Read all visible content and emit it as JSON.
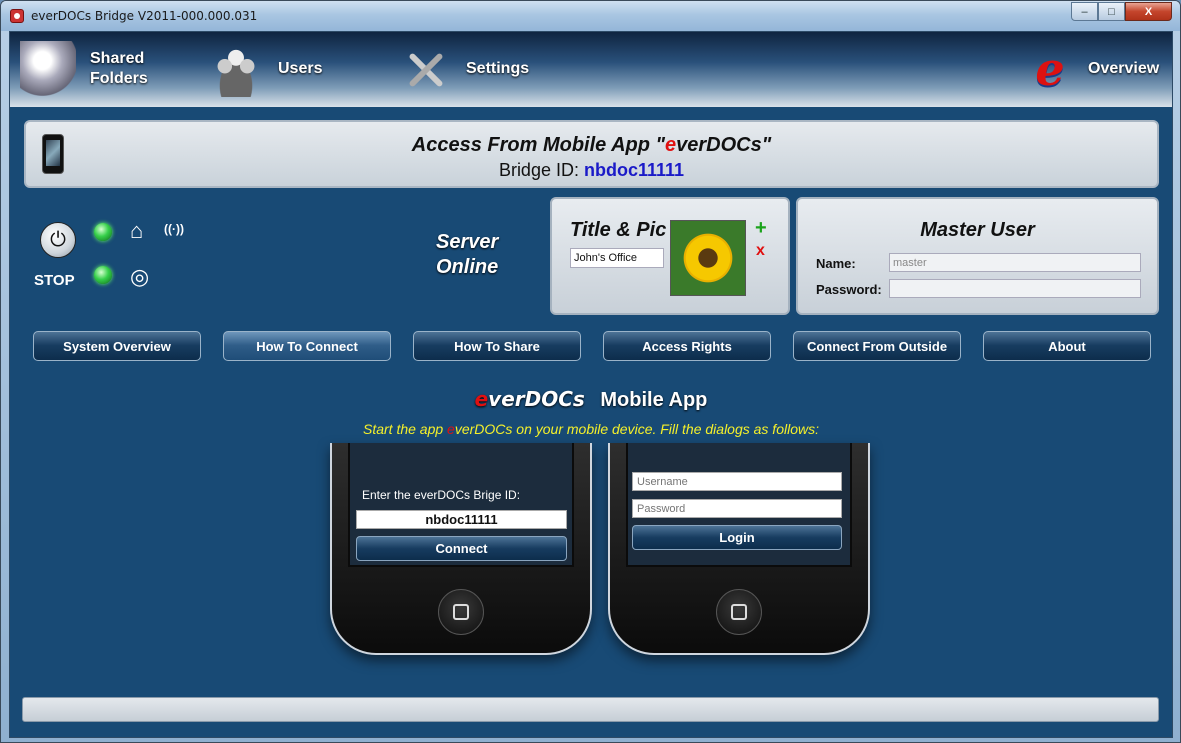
{
  "window": {
    "title": "everDOCs Bridge V2011-000.000.031",
    "min": "–",
    "max": "□",
    "close": "X"
  },
  "nav": {
    "shared_folders": "Shared\nFolders",
    "users": "Users",
    "settings": "Settings",
    "overview": "Overview",
    "overview_logo": "e"
  },
  "access": {
    "prefix": "Access From Mobile App \"",
    "e": "e",
    "rest": "verDOCs\"",
    "bridge_label": "Bridge ID: ",
    "bridge_id": "nbdoc11111"
  },
  "status": {
    "stop": "STOP",
    "server_online": "Server\nOnline",
    "power_icon": "⏻",
    "home_icon": "⌂",
    "wifi_icon": "((·))",
    "globe_icon": "◎"
  },
  "title_pic": {
    "heading": "Title & Pic",
    "name_value": "John's Office",
    "add": "+",
    "delete": "x"
  },
  "master_user": {
    "heading": "Master User",
    "name_label": "Name:",
    "name_value": "master",
    "password_label": "Password:"
  },
  "tabs": [
    {
      "label": "System Overview"
    },
    {
      "label": "How To Connect"
    },
    {
      "label": "How To Share"
    },
    {
      "label": "Access Rights"
    },
    {
      "label": "Connect From Outside"
    },
    {
      "label": "About"
    }
  ],
  "app": {
    "logo_e": "e",
    "logo_rest": "verDOCs",
    "title": "Mobile App",
    "sub_before": "Start the app ",
    "sub_e": "e",
    "sub_after": "verDOCs on your mobile device. Fill the dialogs as follows:"
  },
  "phone1": {
    "label": "Enter the everDOCs Brige ID:",
    "id": "nbdoc11111",
    "button": "Connect"
  },
  "phone2": {
    "username_ph": "Username",
    "password_ph": "Password",
    "button": "Login"
  },
  "colors": {
    "accent_red": "#e01010",
    "bridge_blue": "#1a1ac8",
    "subtitle_yellow": "#f5f02a",
    "led_green": "#36d04a"
  }
}
